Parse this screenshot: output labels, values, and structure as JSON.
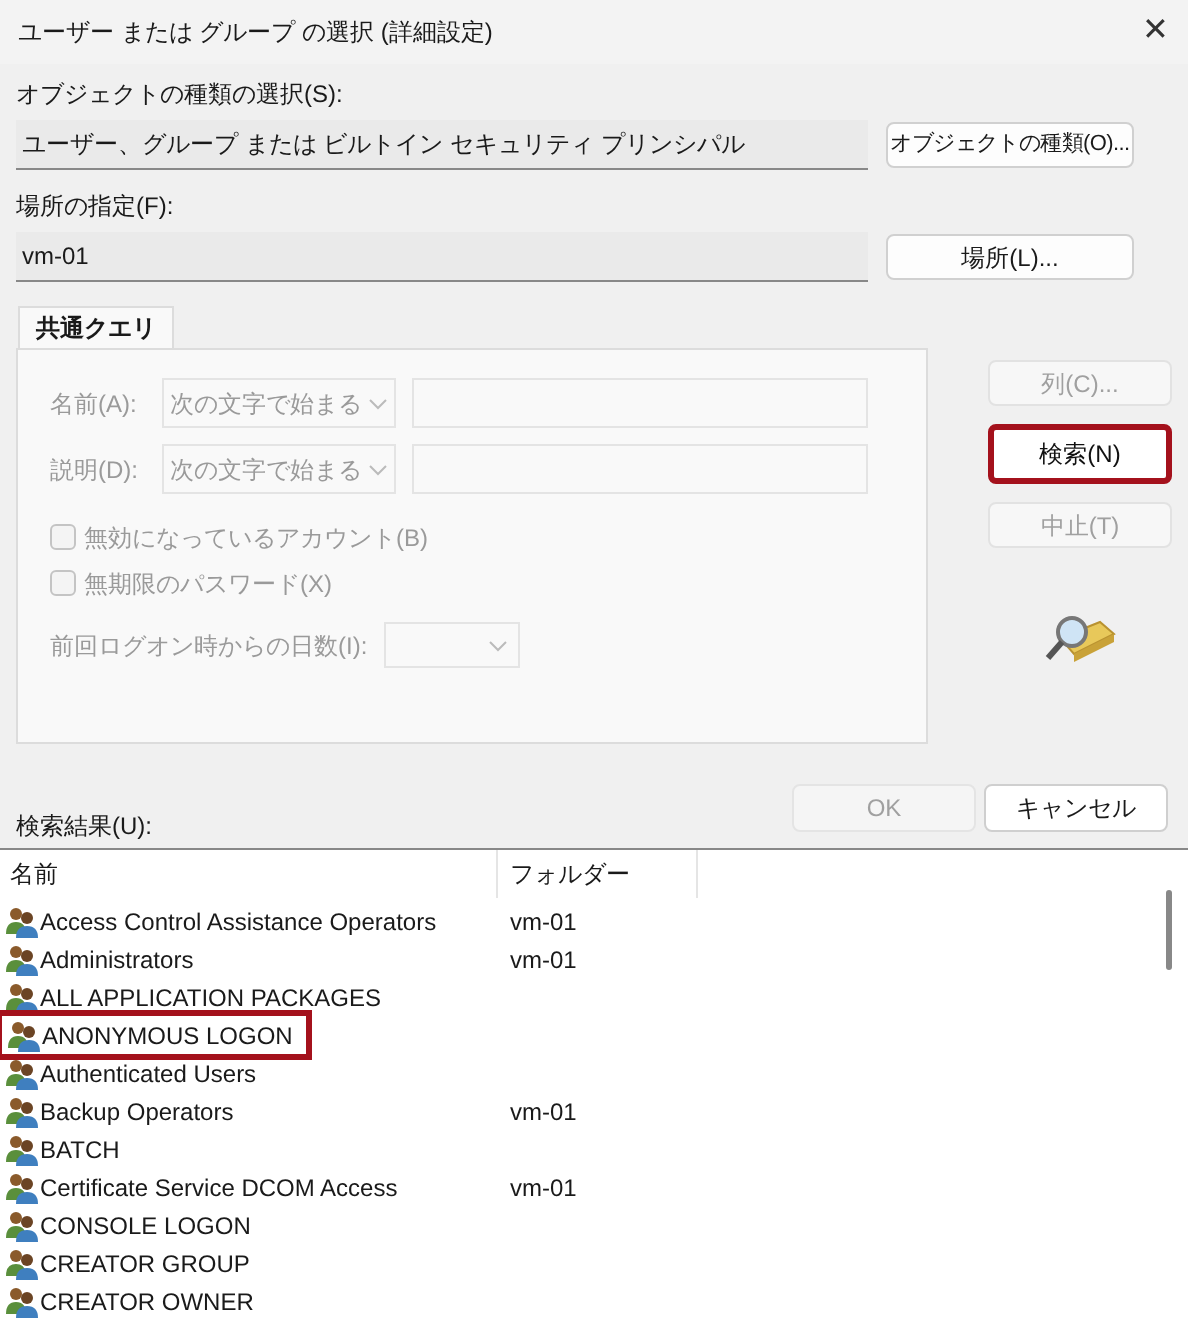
{
  "window": {
    "title": "ユーザー または グループ の選択 (詳細設定)",
    "close": "✕"
  },
  "object_type": {
    "label": "オブジェクトの種類の選択(S):",
    "value": "ユーザー、グループ または ビルトイン セキュリティ プリンシパル",
    "button": "オブジェクトの種類(O)..."
  },
  "location": {
    "label": "場所の指定(F):",
    "value": "vm-01",
    "button": "場所(L)..."
  },
  "tabs": [
    {
      "label": "共通クエリ",
      "selected": true
    }
  ],
  "query": {
    "rows": [
      {
        "label": "名前(A):",
        "mode": "次の文字で始まる"
      },
      {
        "label": "説明(D):",
        "mode": "次の文字で始まる"
      }
    ],
    "checkboxes": [
      {
        "label": "無効になっているアカウント(B)",
        "checked": false
      },
      {
        "label": "無期限のパスワード(X)",
        "checked": false
      }
    ],
    "days_label": "前回ログオン時からの日数(I):",
    "disabled": true
  },
  "side_buttons": [
    {
      "label": "列(C)...",
      "disabled": true,
      "highlighted": false
    },
    {
      "label": "検索(N)",
      "disabled": false,
      "highlighted": true
    },
    {
      "label": "中止(T)",
      "disabled": true,
      "highlighted": false
    }
  ],
  "results_label": "検索結果(U):",
  "buttons": [
    {
      "label": "OK",
      "disabled": true
    },
    {
      "label": "キャンセル",
      "disabled": false
    }
  ],
  "table": {
    "columns": [
      "名前",
      "フォルダー"
    ],
    "rows": [
      {
        "name": "Access Control Assistance Operators",
        "folder": "vm-01",
        "highlighted": false
      },
      {
        "name": "Administrators",
        "folder": "vm-01",
        "highlighted": false
      },
      {
        "name": "ALL APPLICATION PACKAGES",
        "highlighted": false
      },
      {
        "name": "ANONYMOUS LOGON",
        "highlighted": true
      },
      {
        "name": "Authenticated Users",
        "highlighted": false
      },
      {
        "name": "Backup Operators",
        "folder": "vm-01",
        "highlighted": false
      },
      {
        "name": "BATCH",
        "highlighted": false
      },
      {
        "name": "Certificate Service DCOM Access",
        "folder": "vm-01",
        "highlighted": false
      },
      {
        "name": "CONSOLE LOGON",
        "highlighted": false
      },
      {
        "name": "CREATOR GROUP",
        "highlighted": false
      },
      {
        "name": "CREATOR OWNER",
        "highlighted": false
      }
    ]
  }
}
